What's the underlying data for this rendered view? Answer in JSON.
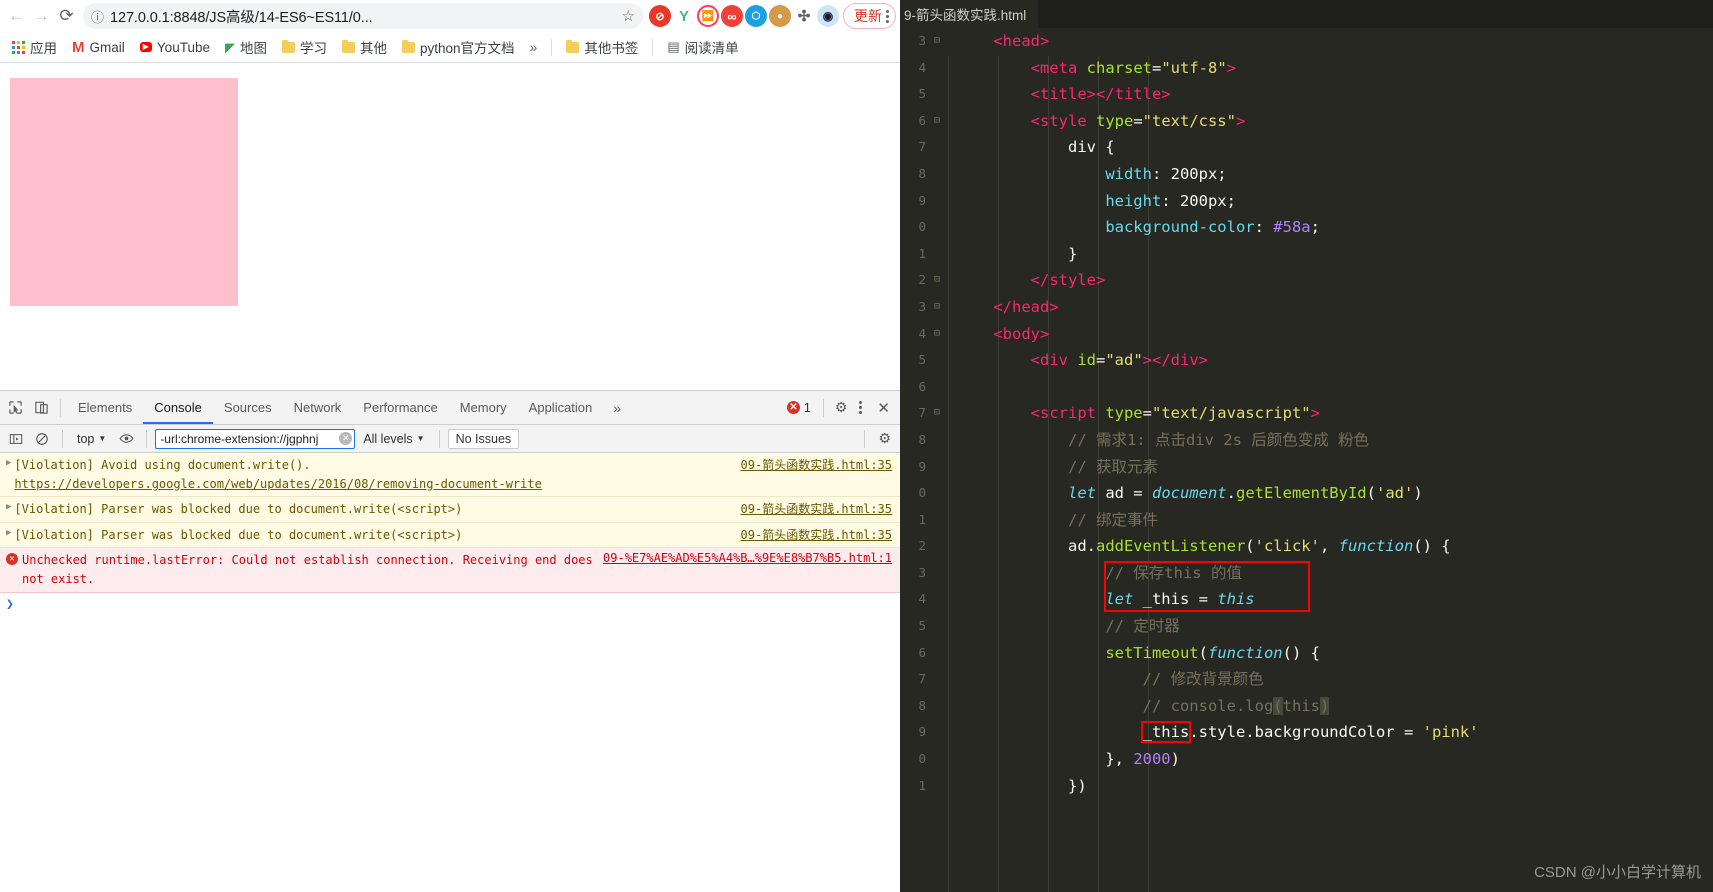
{
  "browser": {
    "nav": {
      "back": "←",
      "forward": "→",
      "reload": "⟳"
    },
    "omnibox": {
      "info_icon": "ⓘ",
      "url": "127.0.0.1:8848/JS高级/14-ES6~ES11/0...",
      "star_icon": "☆"
    },
    "extensions": [
      {
        "name": "adblock-extension-icon",
        "glyph": "⬤",
        "color": "#e8382a"
      },
      {
        "name": "vue-devtools-extension-icon",
        "glyph": "Y",
        "color": "#41b883"
      },
      {
        "name": "video-speed-extension-icon",
        "glyph": "⏩",
        "color": "#ff3b5c"
      },
      {
        "name": "infinity-extension-icon",
        "glyph": "∞",
        "color": "#ef3f36"
      },
      {
        "name": "octotree-extension-icon",
        "glyph": "⬡",
        "color": "#1ba1e2"
      },
      {
        "name": "cookie-editor-extension-icon",
        "glyph": "🍪",
        "color": "#d49a4a"
      },
      {
        "name": "puzzle-extensions-icon",
        "glyph": "✣",
        "color": "#5f6368"
      },
      {
        "name": "record-extension-icon",
        "glyph": "⬤",
        "color": "#1a1a2e"
      }
    ],
    "update_button": {
      "label": "更新"
    },
    "bookmarks": [
      {
        "name": "apps",
        "label": "应用",
        "icon": "apps-grid-icon"
      },
      {
        "name": "gmail",
        "label": "Gmail",
        "icon": "gmail-icon"
      },
      {
        "name": "youtube",
        "label": "YouTube",
        "icon": "youtube-icon"
      },
      {
        "name": "maps",
        "label": "地图",
        "icon": "maps-icon"
      },
      {
        "name": "study",
        "label": "学习",
        "icon": "folder-icon"
      },
      {
        "name": "other",
        "label": "其他",
        "icon": "folder-icon"
      },
      {
        "name": "python-docs",
        "label": "python官方文档",
        "icon": "folder-icon"
      }
    ],
    "bookmarks_overflow": "»",
    "other_bookmarks": {
      "label": "其他书签",
      "icon": "folder-icon"
    },
    "reading_list": {
      "label": "阅读清单",
      "icon": "reading-list-icon"
    }
  },
  "devtools": {
    "tabs": [
      {
        "label": "Elements",
        "active": false
      },
      {
        "label": "Console",
        "active": true
      },
      {
        "label": "Sources",
        "active": false
      },
      {
        "label": "Network",
        "active": false
      },
      {
        "label": "Performance",
        "active": false
      },
      {
        "label": "Memory",
        "active": false
      },
      {
        "label": "Application",
        "active": false
      }
    ],
    "more_tabs": "»",
    "error_count": "1",
    "close_label": "✕",
    "filterbar": {
      "context": "top",
      "filter_value": "-url:chrome-extension://jgphnj",
      "levels": "All levels",
      "issues": "No Issues"
    },
    "messages": [
      {
        "type": "warn",
        "expandable": true,
        "text_before": "[Violation] Avoid using document.write(). ",
        "link_in_text": "https://developers.google.com/web/updates/2016/08/removing-document-write",
        "source": "09-箭头函数实践.html:35"
      },
      {
        "type": "warn",
        "expandable": true,
        "text_before": "[Violation] Parser was blocked due to document.write(<script>)",
        "link_in_text": "",
        "source": "09-箭头函数实践.html:35"
      },
      {
        "type": "warn",
        "expandable": true,
        "text_before": "[Violation] Parser was blocked due to document.write(<script>)",
        "link_in_text": "",
        "source": "09-箭头函数实践.html:35"
      },
      {
        "type": "error",
        "expandable": false,
        "text_before": "Unchecked runtime.lastError: Could not establish connection. Receiving end does not exist.",
        "link_in_text": "",
        "source": "09-%E7%AE%AD%E5%A4%B…%9E%E8%B7%B5.html:1"
      }
    ],
    "prompt": "❯"
  },
  "editor": {
    "tab_label": "9-箭头函数实践.html",
    "watermark": "CSDN @小小白学计算机",
    "lines": [
      {
        "n": "3",
        "fold": "⊟",
        "indent": 1,
        "tokens": [
          {
            "t": "tag",
            "v": "<head>"
          }
        ]
      },
      {
        "n": "4",
        "fold": "",
        "indent": 2,
        "tokens": [
          {
            "t": "tag",
            "v": "<meta "
          },
          {
            "t": "attr",
            "v": "charset"
          },
          {
            "t": "plain",
            "v": "="
          },
          {
            "t": "str",
            "v": "\"utf-8\""
          },
          {
            "t": "tag",
            "v": ">"
          }
        ]
      },
      {
        "n": "5",
        "fold": "",
        "indent": 2,
        "tokens": [
          {
            "t": "tag",
            "v": "<title></title>"
          }
        ]
      },
      {
        "n": "6",
        "fold": "⊟",
        "indent": 2,
        "tokens": [
          {
            "t": "tag",
            "v": "<style "
          },
          {
            "t": "attr",
            "v": "type"
          },
          {
            "t": "plain",
            "v": "="
          },
          {
            "t": "str",
            "v": "\"text/css\""
          },
          {
            "t": "tag",
            "v": ">"
          }
        ]
      },
      {
        "n": "7",
        "fold": "",
        "indent": 3,
        "tokens": [
          {
            "t": "plain",
            "v": "div {"
          }
        ]
      },
      {
        "n": "8",
        "fold": "",
        "indent": 4,
        "tokens": [
          {
            "t": "prop",
            "v": "width"
          },
          {
            "t": "plain",
            "v": ": 200px;"
          }
        ]
      },
      {
        "n": "9",
        "fold": "",
        "indent": 4,
        "tokens": [
          {
            "t": "prop",
            "v": "height"
          },
          {
            "t": "plain",
            "v": ": 200px;"
          }
        ]
      },
      {
        "n": "0",
        "fold": "",
        "indent": 4,
        "tokens": [
          {
            "t": "prop",
            "v": "background-color"
          },
          {
            "t": "plain",
            "v": ": "
          },
          {
            "t": "num",
            "v": "#58a"
          },
          {
            "t": "plain",
            "v": ";"
          }
        ]
      },
      {
        "n": "1",
        "fold": "",
        "indent": 3,
        "tokens": [
          {
            "t": "plain",
            "v": "}"
          }
        ]
      },
      {
        "n": "2",
        "fold": "⊟",
        "indent": 2,
        "tokens": [
          {
            "t": "tag",
            "v": "</style>"
          }
        ]
      },
      {
        "n": "3",
        "fold": "⊟",
        "indent": 1,
        "tokens": [
          {
            "t": "tag",
            "v": "</head>"
          }
        ]
      },
      {
        "n": "4",
        "fold": "⊟",
        "indent": 1,
        "tokens": [
          {
            "t": "tag",
            "v": "<body>"
          }
        ]
      },
      {
        "n": "5",
        "fold": "",
        "indent": 2,
        "tokens": [
          {
            "t": "tag",
            "v": "<div "
          },
          {
            "t": "attr",
            "v": "id"
          },
          {
            "t": "plain",
            "v": "="
          },
          {
            "t": "str",
            "v": "\"ad\""
          },
          {
            "t": "tag",
            "v": "></div>"
          }
        ]
      },
      {
        "n": "6",
        "fold": "",
        "indent": 0,
        "tokens": []
      },
      {
        "n": "7",
        "fold": "⊟",
        "indent": 2,
        "tokens": [
          {
            "t": "tag",
            "v": "<script "
          },
          {
            "t": "attr",
            "v": "type"
          },
          {
            "t": "plain",
            "v": "="
          },
          {
            "t": "str",
            "v": "\"text/javascript\""
          },
          {
            "t": "tag",
            "v": ">"
          }
        ]
      },
      {
        "n": "8",
        "fold": "",
        "indent": 3,
        "tokens": [
          {
            "t": "com",
            "v": "// 需求1: 点击div 2s 后颜色变成 粉色"
          }
        ]
      },
      {
        "n": "9",
        "fold": "",
        "indent": 3,
        "tokens": [
          {
            "t": "com",
            "v": "// 获取元素"
          }
        ]
      },
      {
        "n": "0",
        "fold": "",
        "indent": 3,
        "tokens": [
          {
            "t": "kw",
            "v": "let"
          },
          {
            "t": "plain",
            "v": " ad = "
          },
          {
            "t": "obj",
            "v": "document"
          },
          {
            "t": "plain",
            "v": "."
          },
          {
            "t": "meth",
            "v": "getElementById"
          },
          {
            "t": "plain",
            "v": "("
          },
          {
            "t": "str",
            "v": "'ad'"
          },
          {
            "t": "plain",
            "v": ")"
          }
        ]
      },
      {
        "n": "1",
        "fold": "",
        "indent": 3,
        "tokens": [
          {
            "t": "com",
            "v": "// 绑定事件"
          }
        ]
      },
      {
        "n": "2",
        "fold": "",
        "indent": 3,
        "tokens": [
          {
            "t": "plain",
            "v": "ad."
          },
          {
            "t": "meth",
            "v": "addEventListener"
          },
          {
            "t": "plain",
            "v": "("
          },
          {
            "t": "str",
            "v": "'click'"
          },
          {
            "t": "plain",
            "v": ", "
          },
          {
            "t": "kw",
            "v": "function"
          },
          {
            "t": "plain",
            "v": "() {"
          }
        ]
      },
      {
        "n": "3",
        "fold": "",
        "indent": 4,
        "highlight": "top",
        "tokens": [
          {
            "t": "com",
            "v": "// 保存this 的值"
          }
        ]
      },
      {
        "n": "4",
        "fold": "",
        "indent": 4,
        "highlight": "bottom",
        "tokens": [
          {
            "t": "kw",
            "v": "let"
          },
          {
            "t": "plain",
            "v": " _this = "
          },
          {
            "t": "kw",
            "v": "this"
          }
        ]
      },
      {
        "n": "5",
        "fold": "",
        "indent": 4,
        "tokens": [
          {
            "t": "com",
            "v": "// 定时器"
          }
        ]
      },
      {
        "n": "6",
        "fold": "",
        "indent": 4,
        "tokens": [
          {
            "t": "meth",
            "v": "setTimeout"
          },
          {
            "t": "plain",
            "v": "("
          },
          {
            "t": "kw",
            "v": "function"
          },
          {
            "t": "plain",
            "v": "() {"
          }
        ]
      },
      {
        "n": "7",
        "fold": "",
        "indent": 5,
        "tokens": [
          {
            "t": "com",
            "v": "// 修改背景颜色"
          }
        ]
      },
      {
        "n": "8",
        "fold": "",
        "indent": 5,
        "tokens": [
          {
            "t": "com",
            "v": "// console.log"
          },
          {
            "t": "comsel",
            "v": "("
          },
          {
            "t": "com",
            "v": "this"
          },
          {
            "t": "comsel",
            "v": ")"
          }
        ]
      },
      {
        "n": "9",
        "fold": "",
        "indent": 5,
        "boxword": "_this",
        "tokens": [
          {
            "t": "plain",
            "v": "_this.style.backgroundColor = "
          },
          {
            "t": "str",
            "v": "'pink'"
          }
        ]
      },
      {
        "n": "0",
        "fold": "",
        "indent": 4,
        "tokens": [
          {
            "t": "plain",
            "v": "}, "
          },
          {
            "t": "num",
            "v": "2000"
          },
          {
            "t": "plain",
            "v": ")"
          }
        ]
      },
      {
        "n": "1",
        "fold": "",
        "indent": 3,
        "tokens": [
          {
            "t": "plain",
            "v": "})"
          }
        ]
      }
    ]
  }
}
